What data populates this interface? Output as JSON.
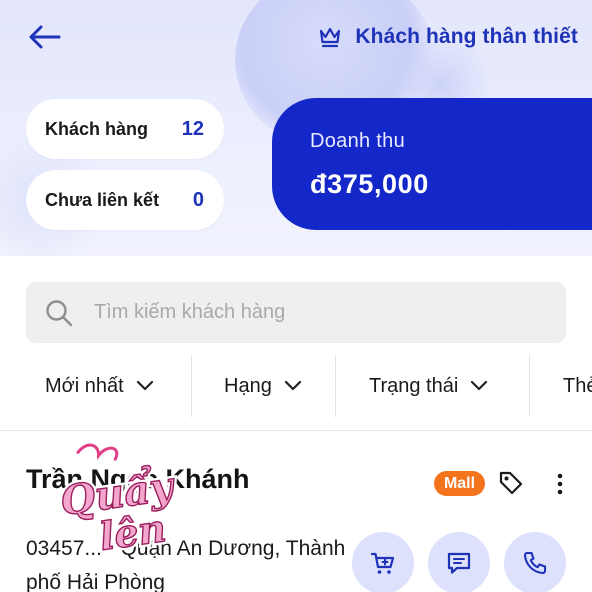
{
  "header": {
    "loyalty_label": "Khách hàng thân thiết",
    "icons": {
      "back": "arrow-left-icon",
      "loyalty": "crown-icon"
    }
  },
  "stats": {
    "customers_label": "Khách hàng",
    "customers_value": "12",
    "unlinked_label": "Chưa liên kết",
    "unlinked_value": "0",
    "revenue_label": "Doanh thu",
    "revenue_value": "đ375,000"
  },
  "search": {
    "placeholder": "Tìm kiếm khách hàng"
  },
  "filters": [
    {
      "label": "Mới nhất"
    },
    {
      "label": "Hạng"
    },
    {
      "label": "Trạng thái"
    },
    {
      "label": "Thẻ"
    }
  ],
  "customer": {
    "name": "Trần Ngọc Khánh",
    "badge": "Mall",
    "address": "03457... - Quận An Dương, Thành phố Hải Phòng",
    "icons": [
      "tag-icon",
      "more-vertical-icon",
      "cart-icon",
      "message-icon",
      "phone-icon"
    ]
  },
  "overlay": {
    "sticker_text": "Quẩy lên"
  },
  "colors": {
    "primary": "#1428c9",
    "accent_text": "#1f33b8",
    "mall_badge": "#f3741d",
    "action_bg": "#dde1fb",
    "search_bg": "#efefef"
  }
}
